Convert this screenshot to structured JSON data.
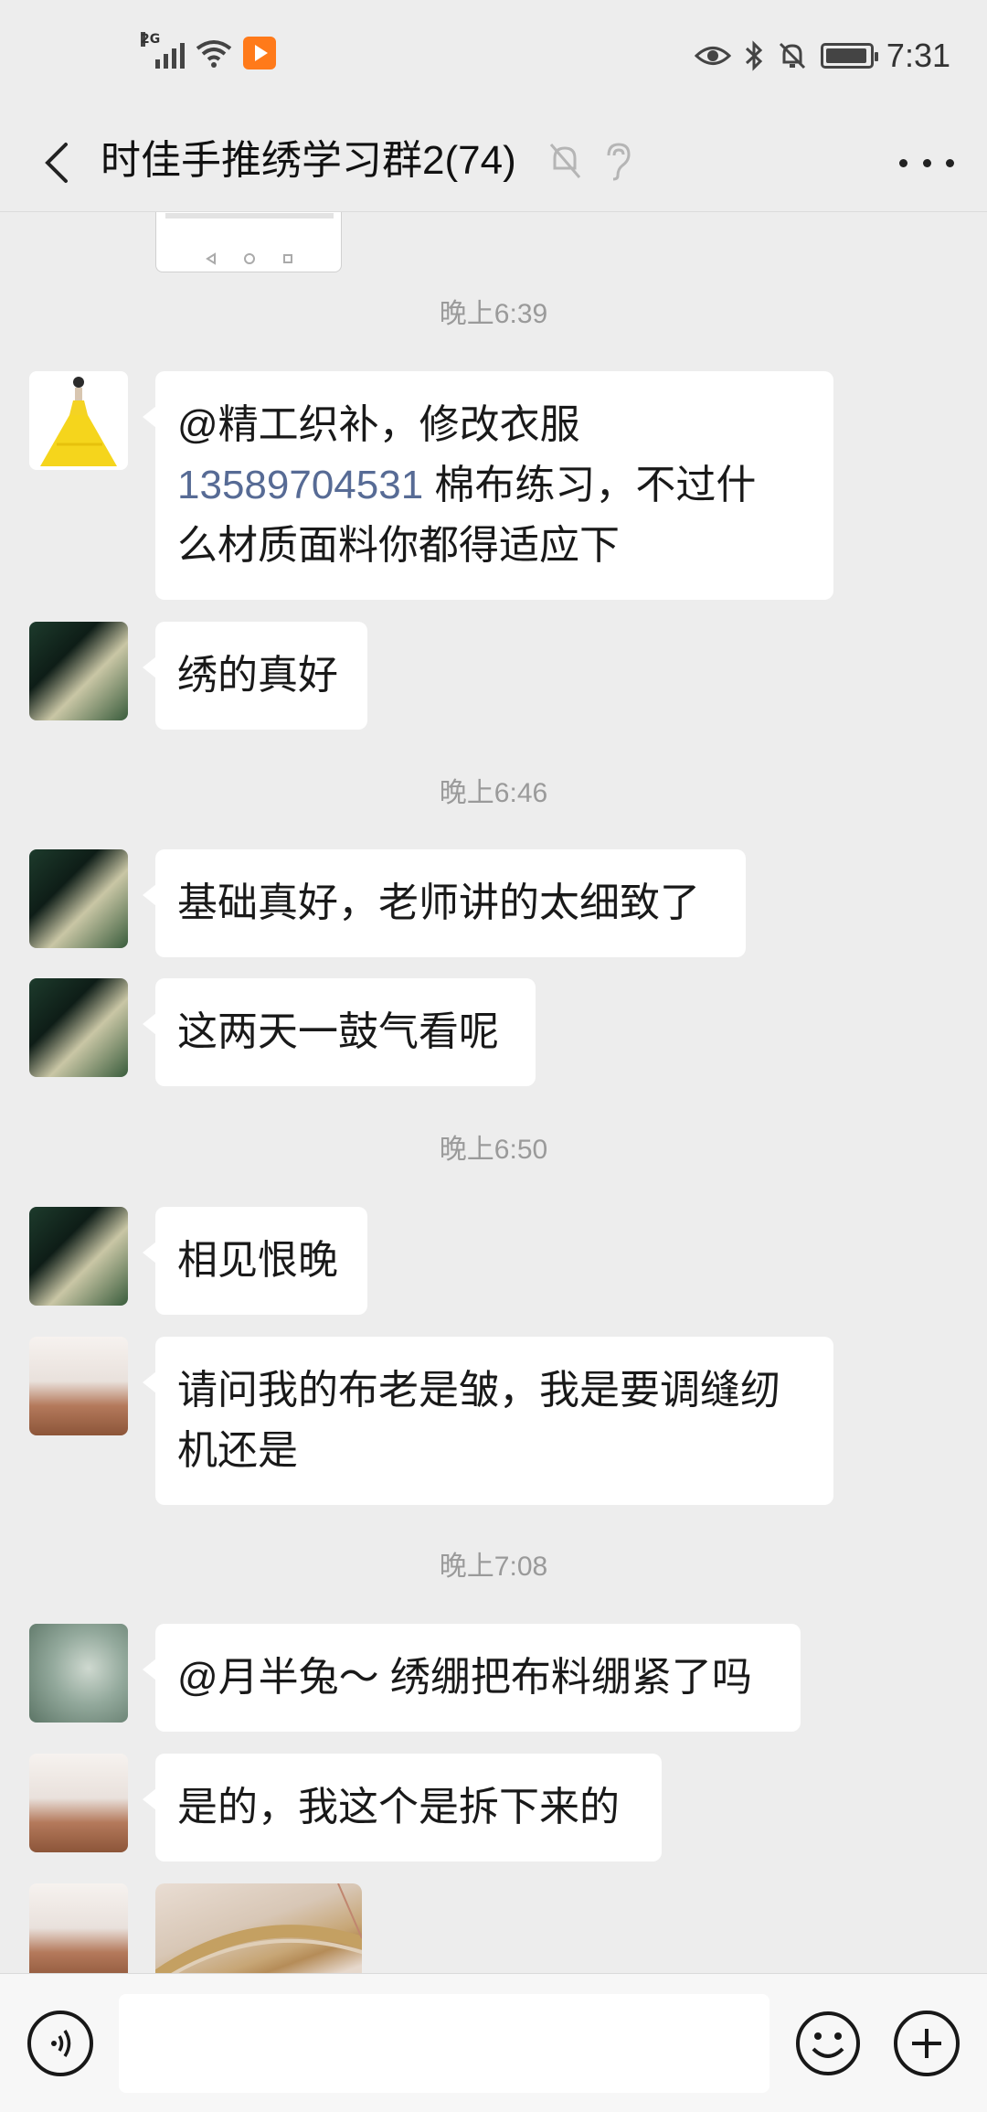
{
  "status_bar": {
    "signal_label": "2G",
    "time": "7:31",
    "battery_percent": 95
  },
  "header": {
    "title": "时佳手推绣学习群2(74)",
    "icons": [
      "back-icon",
      "mute-bell-icon",
      "earpiece-icon",
      "more-icon"
    ]
  },
  "chat": {
    "time_labels": [
      "晚上6:39",
      "晚上6:46",
      "晚上6:50",
      "晚上7:08"
    ],
    "messages": [
      {
        "avatar": "yellow-dress",
        "line1": "@精工织补，修改衣服",
        "phone": "13589704531",
        "line2_rest": " 棉布练习，不过什",
        "line3": "么材质面料你都得适应下"
      },
      {
        "avatar": "dark-portrait",
        "text": "绣的真好"
      },
      {
        "avatar": "dark-portrait",
        "text": "基础真好，老师讲的太细致了"
      },
      {
        "avatar": "dark-portrait",
        "text": "这两天一鼓气看呢"
      },
      {
        "avatar": "dark-portrait",
        "text": "相见恨晚"
      },
      {
        "avatar": "basket",
        "line1": "请问我的布老是皱，我是要调缝纫",
        "line2": "机还是"
      },
      {
        "avatar": "pond",
        "text": "@月半兔～ 绣绷把布料绷紧了吗"
      },
      {
        "avatar": "basket",
        "text": "是的，我这个是拆下来的"
      },
      {
        "avatar": "basket",
        "type": "image"
      }
    ]
  },
  "input_bar": {
    "placeholder": "",
    "icons": [
      "voice-icon",
      "emoji-icon",
      "plus-icon"
    ]
  }
}
